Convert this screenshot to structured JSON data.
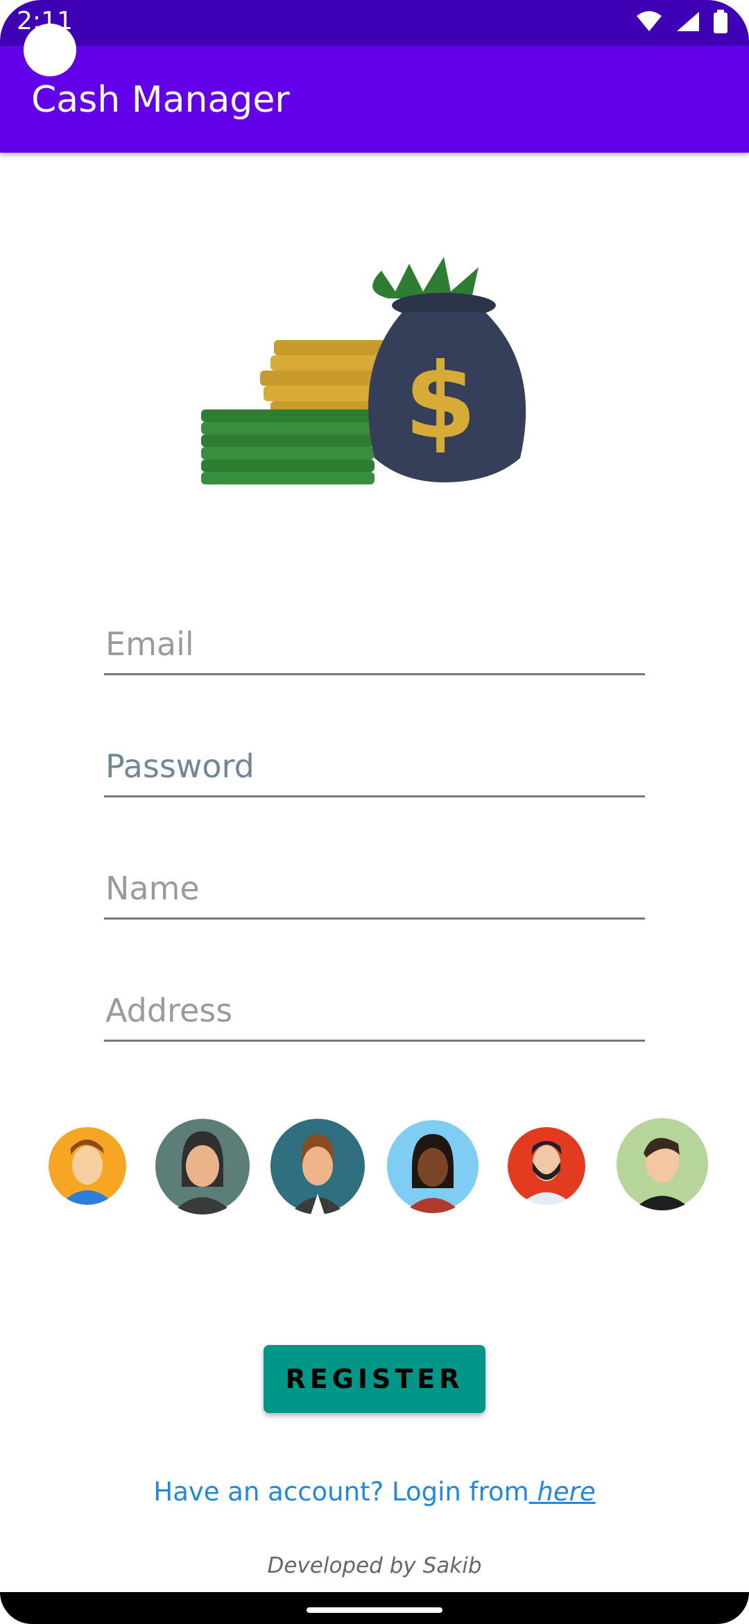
{
  "status_bar": {
    "time": "2:11"
  },
  "app_bar": {
    "title": "Cash Manager"
  },
  "form": {
    "email_placeholder": "Email",
    "password_placeholder": "Password",
    "name_placeholder": "Name",
    "address_placeholder": "Address"
  },
  "avatars": [
    {
      "name": "avatar-1",
      "bg": "#f6a623"
    },
    {
      "name": "avatar-2",
      "bg": "#5c7d78"
    },
    {
      "name": "avatar-3",
      "bg": "#2f6f80"
    },
    {
      "name": "avatar-4",
      "bg": "#7fcdf3"
    },
    {
      "name": "avatar-5",
      "bg": "#e23b1f"
    },
    {
      "name": "avatar-6",
      "bg": "#b6d59a"
    }
  ],
  "actions": {
    "register_label": "REGISTER"
  },
  "login": {
    "prefix": "Have an account? Login from",
    "link": " here"
  },
  "footer": {
    "developer": "Developed by Sakib"
  },
  "colors": {
    "status_bar": "#3f00b5",
    "app_bar": "#6200ea",
    "button": "#009688",
    "link": "#1e88e5"
  }
}
